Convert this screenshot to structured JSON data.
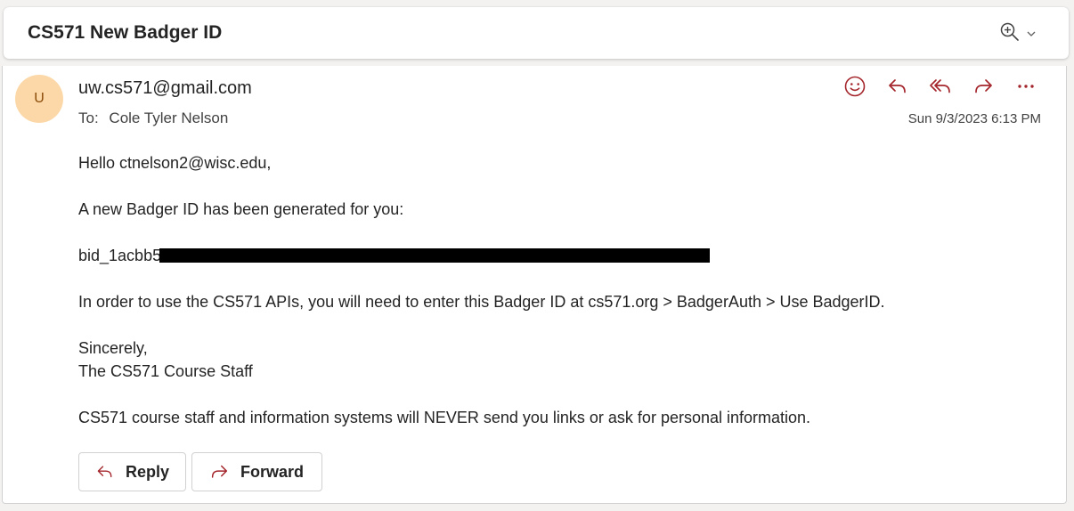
{
  "subject": "CS571 New Badger ID",
  "zoom": {
    "icon": "zoom-in-icon",
    "chevron_icon": "chevron-down-icon"
  },
  "message": {
    "avatar_initial": "U",
    "sender": "uw.cs571@gmail.com",
    "to_label": "To:",
    "to_name": "Cole Tyler Nelson",
    "date": "Sun 9/3/2023 6:13 PM",
    "actions": [
      {
        "name": "emoji-react-icon",
        "label": "React"
      },
      {
        "name": "reply-icon",
        "label": "Reply"
      },
      {
        "name": "reply-all-icon",
        "label": "Reply all"
      },
      {
        "name": "forward-icon",
        "label": "Forward"
      },
      {
        "name": "more-actions-icon",
        "label": "More actions"
      }
    ],
    "body": {
      "greeting": "Hello ctnelson2@wisc.edu,",
      "intro": "A new Badger ID has been generated for you:",
      "badger_id_prefix": "bid_1acbb5",
      "instructions": "In order to use the CS571 APIs, you will need to enter this Badger ID at cs571.org > BadgerAuth > Use BadgerID.",
      "closing": "Sincerely,",
      "signature": "The CS571 Course Staff",
      "notice": "CS571 course staff and information systems will NEVER send you links or ask for personal information."
    },
    "buttons": {
      "reply": "Reply",
      "forward": "Forward"
    }
  },
  "colors": {
    "accent_icon": "#a4262c",
    "avatar_bg": "#fcd8a8",
    "avatar_text": "#8a4b08"
  }
}
